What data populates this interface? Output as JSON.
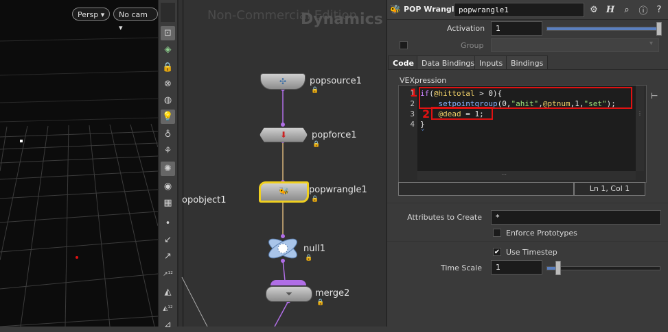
{
  "viewport": {
    "persp_label": "Persp ▾",
    "cam_label": "No cam ▾"
  },
  "network": {
    "watermark_1": "Non-Commercial Edition",
    "watermark_2": "Dynamics",
    "side_label": "opobject1",
    "nodes": {
      "popsource": "popsource1",
      "popforce": "popforce1",
      "popwrangle": "popwrangle1",
      "null": "null1",
      "merge": "merge2"
    }
  },
  "params": {
    "node_type": "POP Wrangle",
    "node_name": "popwrangle1",
    "activation_label": "Activation",
    "activation_value": "1",
    "group_label": "Group",
    "tabs": [
      "Code",
      "Data Bindings",
      "Inputs",
      "Bindings"
    ],
    "vex_label": "VEXpression",
    "status": "Ln 1, Col 1",
    "annotations": [
      "1",
      "2"
    ],
    "attrs_label": "Attributes to Create",
    "attrs_value": "*",
    "enforce_label": "Enforce Prototypes",
    "timestep_label": "Use Timestep",
    "timescale_label": "Time Scale",
    "timescale_value": "1"
  },
  "code": {
    "line_numbers": [
      "1",
      "2",
      "3",
      "4"
    ],
    "l1_kw": "if",
    "l1_a": "(",
    "l1_attr": "@hittotal",
    "l1_b": " > 0){",
    "l2_indent": "    ",
    "l2_fn": "setpointgroup",
    "l2_a": "(0,",
    "l2_s1": "\"ahit\"",
    "l2_b": ",",
    "l2_attr": "@ptnum",
    "l2_c": ",1,",
    "l2_s2": "\"set\"",
    "l2_d": ");",
    "l3_indent": "    ",
    "l3_attr": "@dead",
    "l3_rest": " = 1;",
    "l4": "}"
  },
  "colors": {
    "accent_red": "#e01212",
    "wire_purple": "#b06ee6",
    "selected_yellow": "#f0d020"
  }
}
